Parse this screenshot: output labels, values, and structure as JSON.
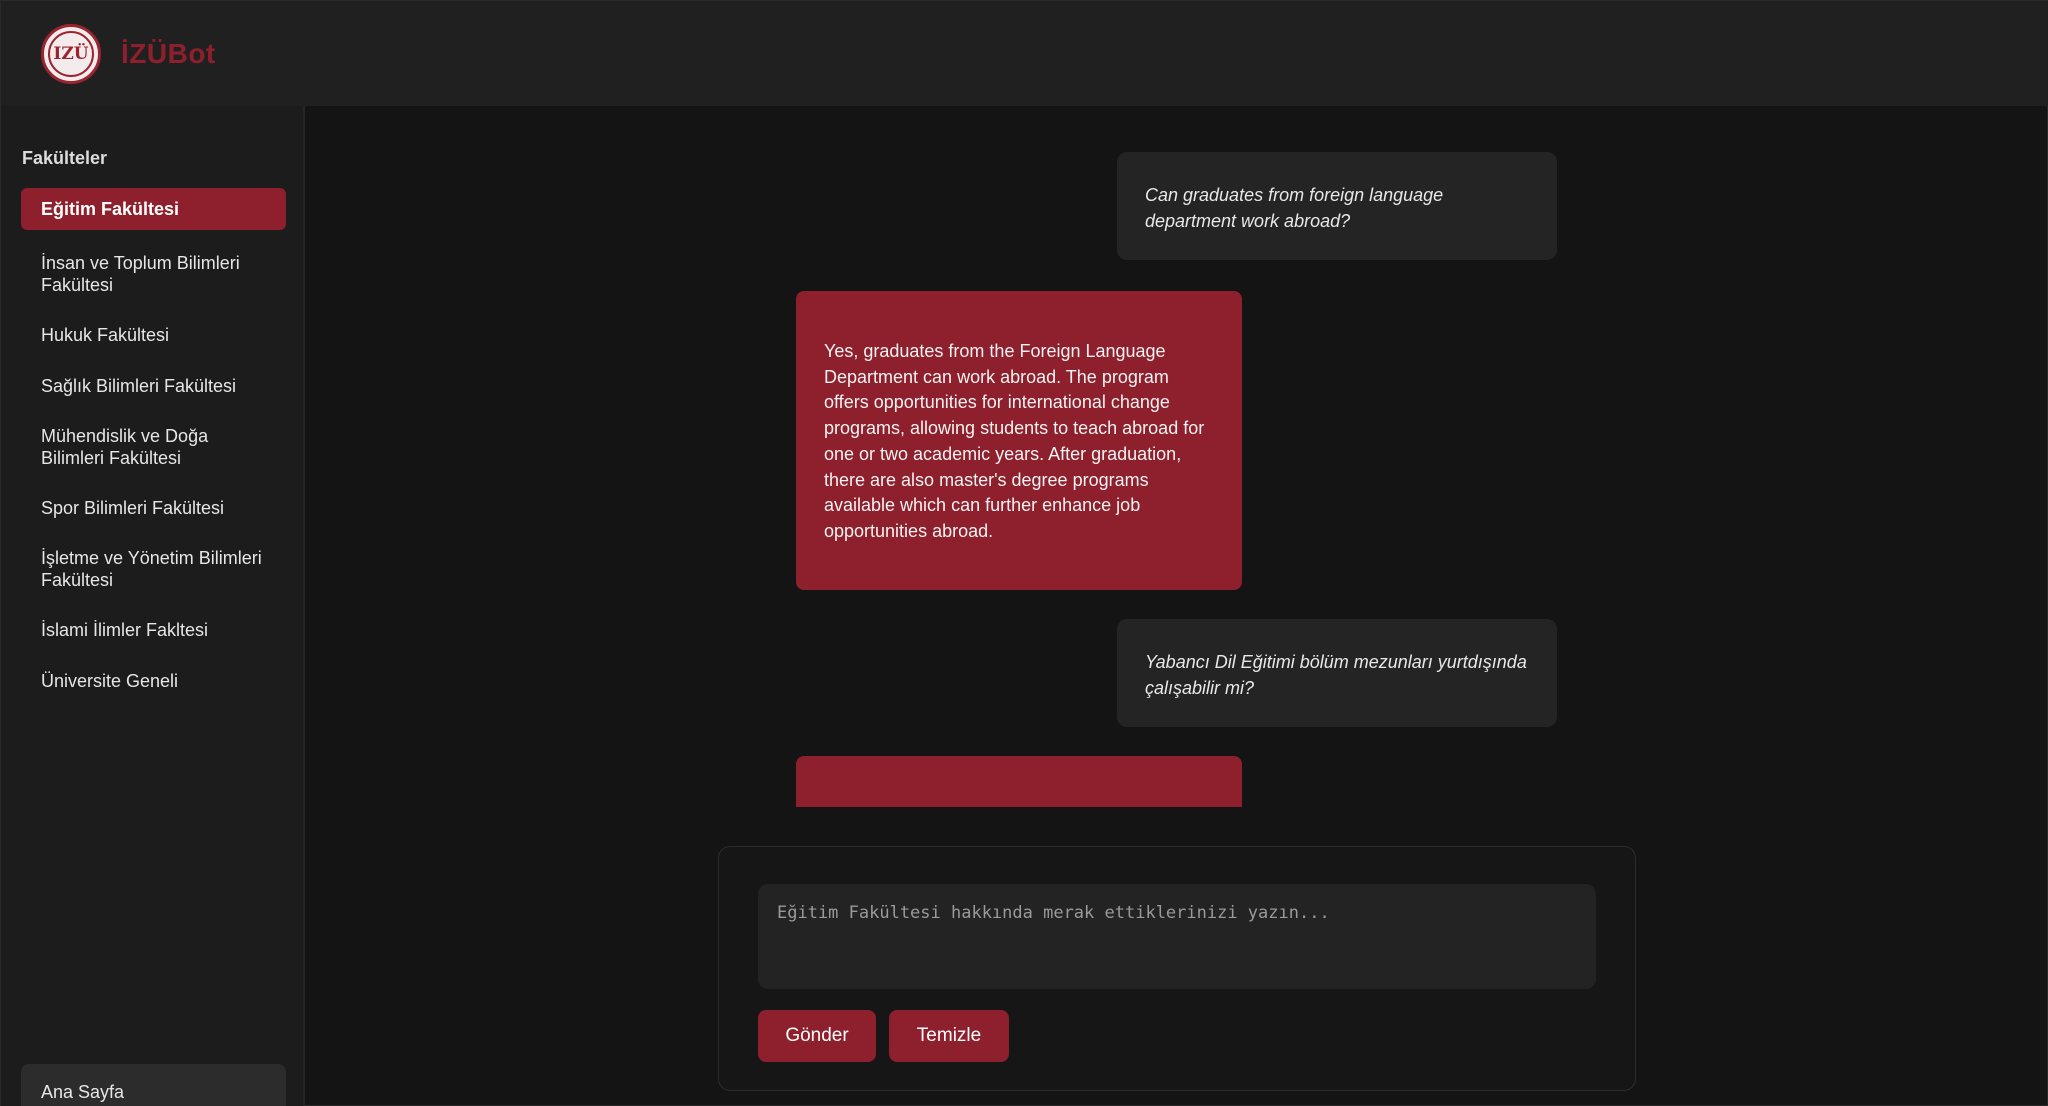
{
  "header": {
    "logo_icon": "izu-logo-icon",
    "logo_text": "IZÜ",
    "app_title": "İZÜBot"
  },
  "sidebar": {
    "heading": "Fakülteler",
    "items": [
      {
        "label": "Eğitim Fakültesi",
        "active": true
      },
      {
        "label": "İnsan ve Toplum Bilimleri Fakültesi"
      },
      {
        "label": "Hukuk Fakültesi"
      },
      {
        "label": "Sağlık Bilimleri Fakültesi"
      },
      {
        "label": "Mühendislik ve Doğa Bilimleri Fakültesi"
      },
      {
        "label": "Spor Bilimleri Fakültesi"
      },
      {
        "label": "İşletme ve Yönetim Bilimleri Fakültesi"
      },
      {
        "label": "İslami İlimler Fakltesi"
      },
      {
        "label": "Üniversite Geneli"
      }
    ],
    "home_label": "Ana Sayfa"
  },
  "chat": {
    "messages": [
      {
        "role": "user",
        "text": "Can graduates from foreign language department work abroad?"
      },
      {
        "role": "bot",
        "text": "Yes, graduates from the Foreign Language Department can work abroad. The program offers opportunities for international change programs, allowing students to teach abroad for one or two academic years. After graduation, there are also master's degree programs available which can further enhance job opportunities abroad."
      },
      {
        "role": "user",
        "text": "Yabancı Dil Eğitimi bölüm mezunları yurtdışında çalışabilir mi?"
      },
      {
        "role": "bot",
        "text": ""
      }
    ]
  },
  "input": {
    "placeholder": "Eğitim Fakültesi hakkında merak ettiklerinizi yazın...",
    "value": "",
    "send_label": "Gönder",
    "clear_label": "Temizle"
  },
  "colors": {
    "accent": "#8e1f2c",
    "background": "#141414",
    "header": "#202020",
    "sidebar": "#1c1c1c",
    "user_bubble": "#242424"
  }
}
